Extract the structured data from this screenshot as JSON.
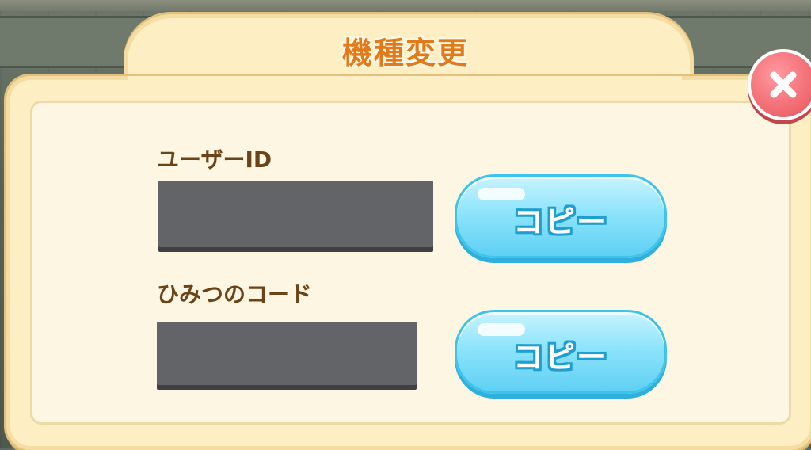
{
  "dialog": {
    "title": "機種変更"
  },
  "user_id": {
    "label": "ユーザーID",
    "copy_label": "コピー"
  },
  "secret_code": {
    "label": "ひみつのコード",
    "copy_label": "コピー"
  },
  "close_button": {
    "icon": "close-icon"
  },
  "colors": {
    "title": "#e07a1a",
    "label": "#6a4417",
    "copy_button": "#5fd0f3",
    "close_button": "#f26d74",
    "panel": "#fdf6e2"
  }
}
